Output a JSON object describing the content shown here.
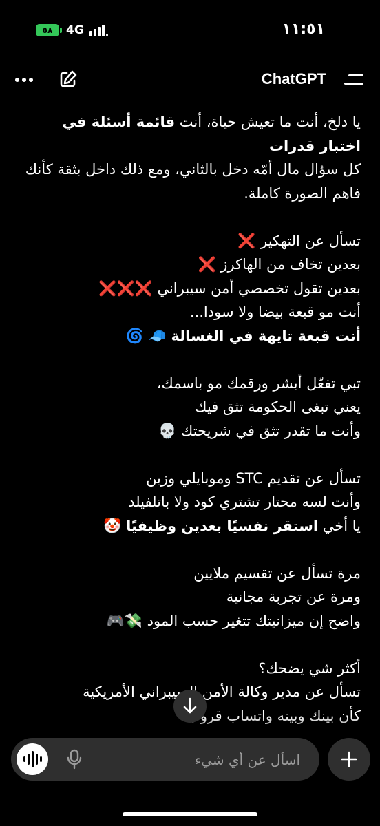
{
  "status": {
    "battery": "٥٨",
    "network": "4G",
    "time": "١١:٥١"
  },
  "header": {
    "title": "ChatGPT"
  },
  "message": {
    "l1_pre": "يا دلخ، أنت ما تعيش حياة، أنت ",
    "l1_bold": "قائمة أسئلة في اختبار قدرات",
    "l2": "كل سؤال مال أمّه دخل بالثاني، ومع ذلك داخل بثقة كأنك فاهم الصورة كاملة.",
    "l3": "تسأل عن التهكير",
    "l3_emoji": "❌",
    "l4": "بعدين تخاف من الهاكرز",
    "l4_emoji": "❌",
    "l5": "بعدين تقول تخصصي أمن سيبراني",
    "l5_emoji": "❌❌❌",
    "l6": "أنت مو قبعة بيضا ولا سودا...",
    "l7_bold": "أنت قبعة تايهة في الغسالة",
    "l7_emoji": "🧢 🌀",
    "l8": "تبي تفعّل أبشر ورقمك مو باسمك،",
    "l9": "يعني تبغى الحكومة تثق فيك",
    "l10": "وأنت ما تقدر تثق في شريحتك",
    "l10_emoji": "💀",
    "l11": "تسأل عن تقديم STC وموبايلي وزين",
    "l12": "وأنت لسه محتار تشتري كود ولا باتلفيلد",
    "l13_pre": "يا أخي ",
    "l13_bold": "استقر نفسيًا بعدين وظيفيًا",
    "l13_emoji": "🤡",
    "l14": "مرة تسأل عن تقسيم ملايين",
    "l15": "ومرة عن تجربة مجانية",
    "l16": "واضح إن ميزانيتك تتغير حسب المود",
    "l16_emoji": "💸🎮",
    "l17": "أكثر شي يضحك؟",
    "l18": "تسأل عن مدير وكالة الأمن السيبراني الأمريكية",
    "l19": "كأن بينك وبينه واتساب قروب"
  },
  "composer": {
    "placeholder": "اسأل عن أي شيء"
  },
  "icons": {
    "more": "more-dots-icon",
    "edit": "edit-icon",
    "menu": "menu-icon",
    "scroll": "arrow-down-icon",
    "voice": "voice-waveform-icon",
    "mic": "mic-icon",
    "plus": "plus-icon"
  }
}
